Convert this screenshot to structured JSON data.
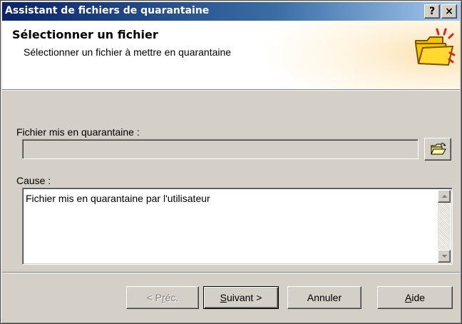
{
  "window": {
    "title": "Assistant de fichiers de quarantaine",
    "help_button": "?",
    "close_button": "×"
  },
  "header": {
    "title": "Sélectionner un fichier",
    "subtitle": "Sélectionner un fichier à mettre en quarantaine",
    "art_icon": "open-folder-icon"
  },
  "form": {
    "file_label": "Fichier mis en quarantaine :",
    "file_value": "",
    "browse_icon": "open-folder-icon",
    "cause_label": "Cause :",
    "cause_value": "Fichier mis en quarantaine par l'utilisateur"
  },
  "buttons": {
    "prev": {
      "prefix": "< P",
      "mnemonic": "r",
      "suffix": "éc.",
      "enabled": false
    },
    "next": {
      "prefix": "",
      "mnemonic": "S",
      "suffix": "uivant >",
      "enabled": true
    },
    "cancel": {
      "label": "Annuler"
    },
    "help": {
      "prefix": "",
      "mnemonic": "A",
      "suffix": "ide"
    }
  },
  "colors": {
    "titlebar_start": "#0a246a",
    "titlebar_end": "#a6caf0",
    "face": "#d4d0c8",
    "folder": "#f5c400"
  }
}
